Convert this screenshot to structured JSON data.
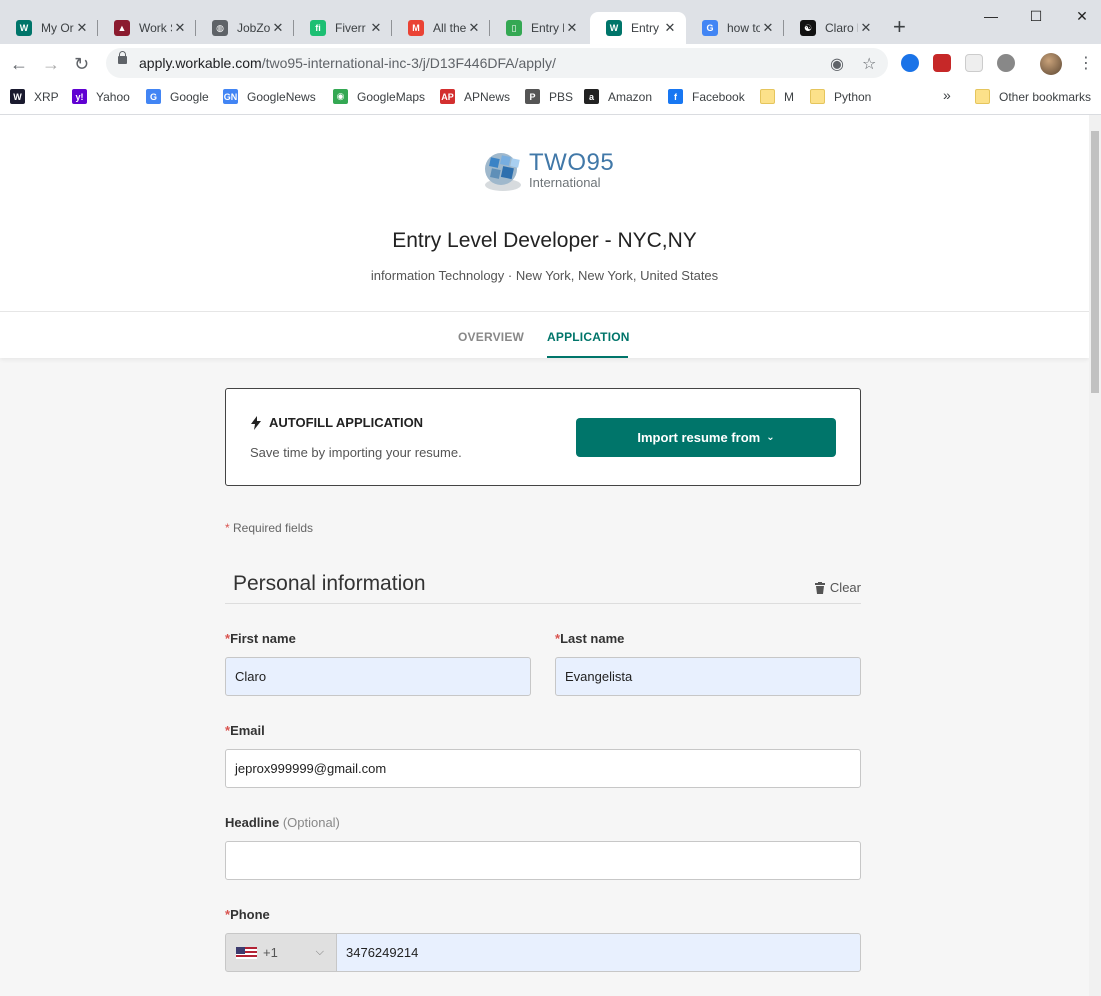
{
  "browser": {
    "tabs": [
      {
        "title": "My Or",
        "color": "#00756a",
        "glyph": "W"
      },
      {
        "title": "Work S",
        "color": "#8b1b2f",
        "glyph": "▲"
      },
      {
        "title": "JobZo",
        "color": "#5f6368",
        "glyph": "◍"
      },
      {
        "title": "Fiverr",
        "color": "#1dbf73",
        "glyph": "fi"
      },
      {
        "title": "All the",
        "color": "#ea4335",
        "glyph": "M"
      },
      {
        "title": "Entry l",
        "color": "#34a853",
        "glyph": "▯"
      },
      {
        "title": "Entry l",
        "color": "#00756a",
        "glyph": "W"
      },
      {
        "title": "how to",
        "color": "#4285f4",
        "glyph": "G"
      },
      {
        "title": "Claro l",
        "color": "#111111",
        "glyph": "☯"
      }
    ],
    "url_host": "apply.workable.com",
    "url_path": "/two95-international-inc-3/j/D13F446DFA/apply/",
    "bookmarks": [
      {
        "label": "XRP",
        "color": "#1a1a2e",
        "glyph": "W"
      },
      {
        "label": "Yahoo",
        "color": "#6001d2",
        "glyph": "y!"
      },
      {
        "label": "Google",
        "color": "#4285f4",
        "glyph": "G"
      },
      {
        "label": "GoogleNews",
        "color": "#4285f4",
        "glyph": "GN"
      },
      {
        "label": "GoogleMaps",
        "color": "#34a853",
        "glyph": "◉"
      },
      {
        "label": "APNews",
        "color": "#d32f2f",
        "glyph": "AP"
      },
      {
        "label": "PBS",
        "color": "#555555",
        "glyph": "P"
      },
      {
        "label": "Amazon",
        "color": "#222222",
        "glyph": "a"
      },
      {
        "label": "Facebook",
        "color": "#1877f2",
        "glyph": "f"
      },
      {
        "label": "M",
        "color": "folder",
        "glyph": ""
      },
      {
        "label": "Python",
        "color": "folder",
        "glyph": ""
      }
    ],
    "overflow": "»",
    "other_bookmarks": "Other bookmarks"
  },
  "company": {
    "logo_main": "TWO95",
    "logo_sub": "International"
  },
  "job": {
    "title": "Entry Level Developer - NYC,NY",
    "subtitle": "information Technology · New York, New York, United States"
  },
  "tabs": {
    "overview": "OVERVIEW",
    "application": "APPLICATION"
  },
  "autofill": {
    "title": "AUTOFILL APPLICATION",
    "description": "Save time by importing your resume.",
    "button": "Import resume from"
  },
  "form": {
    "required_note": "Required fields",
    "section_title": "Personal information",
    "clear_label": "Clear",
    "first_name": {
      "label": "First name",
      "value": "Claro"
    },
    "last_name": {
      "label": "Last name",
      "value": "Evangelista"
    },
    "email": {
      "label": "Email",
      "value": "jeprox999999@gmail.com"
    },
    "headline": {
      "label": "Headline",
      "optional": "(Optional)",
      "value": ""
    },
    "phone": {
      "label": "Phone",
      "country_code": "+1",
      "value": "3476249214"
    }
  },
  "colors": {
    "accent": "#00756a",
    "required": "#d9534f",
    "autofilled": "#e8f0fe"
  }
}
